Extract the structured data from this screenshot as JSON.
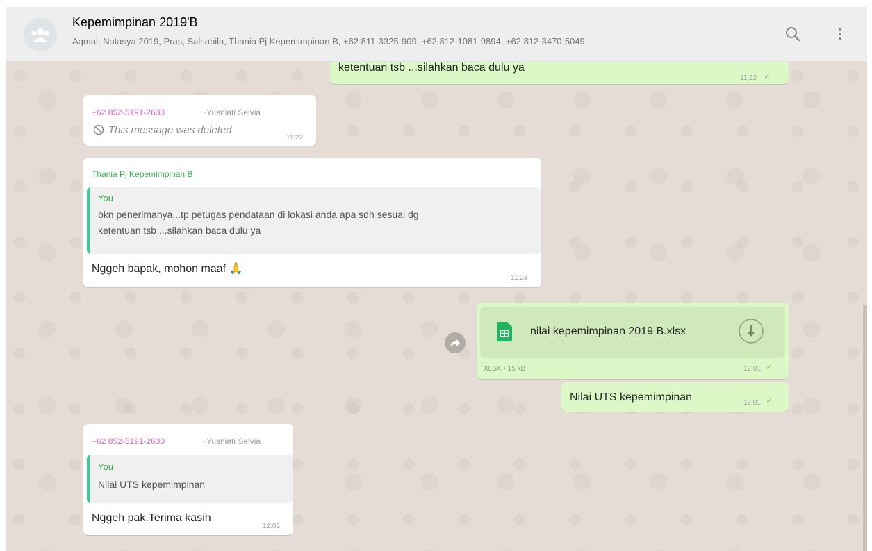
{
  "header": {
    "title": "Kepemimpinan 2019'B",
    "participants": "Aqmal, Natasya 2019, Pras, Salsabila, Thania Pj Kepemimpinan B, +62 811-3325-909, +62 812-1081-9894, +62 812-3470-5049..."
  },
  "messages": {
    "m1": {
      "text": "ketentuan tsb ...silahkan baca dulu ya",
      "time": "11:22"
    },
    "m2": {
      "phone": "+62 852-5191-2630",
      "name": "~Yusniati Selvia",
      "text": "This message was deleted",
      "time": "11:22"
    },
    "m3": {
      "sender": "Thania Pj Kepemimpinan B",
      "quote_author": "You",
      "quote_line1": "bkn penerimanya...tp petugas pendataan di lokasi anda apa sdh sesuai dg",
      "quote_line2": "ketentuan tsb ...silahkan baca dulu ya",
      "text": "Nggeh bapak, mohon maaf 🙏",
      "time": "11:23"
    },
    "m4": {
      "file_name": "nilai kepemimpinan 2019 B.xlsx",
      "file_meta": "XLSX • 15 kB",
      "time": "12:01"
    },
    "m5": {
      "text": "Nilai UTS kepemimpinan",
      "time": "12:01"
    },
    "m6": {
      "phone": "+62 852-5191-2630",
      "name": "~Yusniati Selvia",
      "quote_author": "You",
      "quote_text": "Nilai UTS kepemimpinan",
      "text": "Nggeh pak.Terima kasih",
      "time": "12:02"
    }
  },
  "colors": {
    "incoming_bubble": "#ffffff",
    "outgoing_bubble": "#dcf8c6",
    "chat_background": "#e5ddd5",
    "quote_bar": "#35cd96",
    "sender_phone": "#e063b6",
    "sender_green": "#35b04a"
  },
  "icons": [
    "group-avatar-icon",
    "search-icon",
    "menu-icon",
    "deleted-icon",
    "spreadsheet-file-icon",
    "download-icon",
    "forward-icon",
    "double-check-icon"
  ]
}
